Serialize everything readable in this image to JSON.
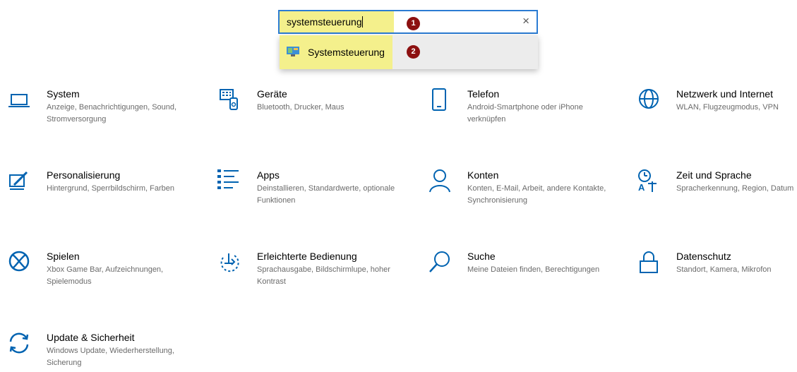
{
  "search": {
    "query": "systemsteuerung",
    "clear_icon": "×",
    "badge1": "1"
  },
  "dropdown": {
    "suggestion": "Systemsteuerung",
    "badge2": "2"
  },
  "tiles": [
    {
      "title": "System",
      "desc": "Anzeige, Benachrichtigungen, Sound, Stromversorgung",
      "icon": "laptop-icon"
    },
    {
      "title": "Geräte",
      "desc": "Bluetooth, Drucker, Maus",
      "icon": "devices-icon"
    },
    {
      "title": "Telefon",
      "desc": "Android-Smartphone oder iPhone verknüpfen",
      "icon": "phone-icon"
    },
    {
      "title": "Netzwerk und Internet",
      "desc": "WLAN, Flugzeugmodus, VPN",
      "icon": "globe-icon"
    },
    {
      "title": "Personalisierung",
      "desc": "Hintergrund, Sperrbildschirm, Farben",
      "icon": "personalization-icon"
    },
    {
      "title": "Apps",
      "desc": "Deinstallieren, Standardwerte, optionale Funktionen",
      "icon": "apps-list-icon"
    },
    {
      "title": "Konten",
      "desc": "Konten, E-Mail, Arbeit, andere Kontakte, Synchronisierung",
      "icon": "person-icon"
    },
    {
      "title": "Zeit und Sprache",
      "desc": "Spracherkennung, Region, Datum",
      "icon": "time-language-icon"
    },
    {
      "title": "Spielen",
      "desc": "Xbox Game Bar, Aufzeichnungen, Spielemodus",
      "icon": "xbox-icon"
    },
    {
      "title": "Erleichterte Bedienung",
      "desc": "Sprachausgabe, Bildschirmlupe, hoher Kontrast",
      "icon": "ease-of-access-icon"
    },
    {
      "title": "Suche",
      "desc": "Meine Dateien finden, Berechtigungen",
      "icon": "search-icon"
    },
    {
      "title": "Datenschutz",
      "desc": "Standort, Kamera, Mikrofon",
      "icon": "lock-icon"
    },
    {
      "title": "Update & Sicherheit",
      "desc": "Windows Update, Wiederherstellung, Sicherung",
      "icon": "update-sync-icon"
    }
  ],
  "colors": {
    "accent": "#0063b1",
    "highlight": "#f4f08c",
    "badge": "#8c1010",
    "search_border": "#2b7cd3"
  }
}
